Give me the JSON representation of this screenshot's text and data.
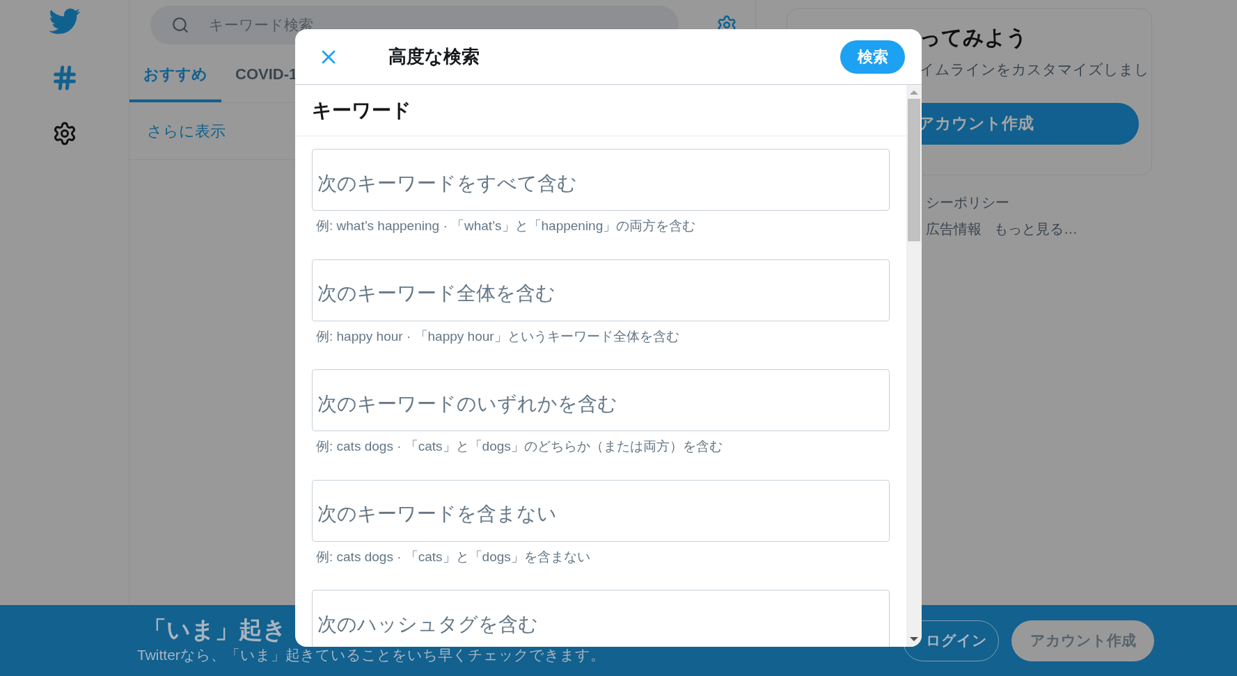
{
  "search": {
    "placeholder": "キーワード検索"
  },
  "tabs": [
    {
      "label": "おすすめ",
      "selected": true
    },
    {
      "label": "COVID-1",
      "selected": false
    }
  ],
  "show_more": "さらに表示",
  "side_card": {
    "title": "ってみよう",
    "text": "イムラインをカスタマイズしまし",
    "button": "アカウント作成"
  },
  "footer_links": [
    "シーポリシー",
    "広告情報",
    "もっと見る…"
  ],
  "banner": {
    "title": "「いま」起き",
    "subtitle": "Twitterなら、「いま」起きていることをいち早くチェックできます。",
    "buttons": [
      {
        "label": "ログイン",
        "kind": "outline"
      },
      {
        "label": "アカウント作成",
        "kind": "filled"
      }
    ]
  },
  "dialog": {
    "title": "高度な検索",
    "search_button": "検索",
    "section": "キーワード",
    "fields": [
      {
        "placeholder": "次のキーワードをすべて含む",
        "hint": "例: what’s happening · 「what’s」と「happening」の両方を含む"
      },
      {
        "placeholder": "次のキーワード全体を含む",
        "hint": "例: happy hour · 「happy hour」というキーワード全体を含む"
      },
      {
        "placeholder": "次のキーワードのいずれかを含む",
        "hint": "例: cats dogs · 「cats」と「dogs」のどちらか（または両方）を含む"
      },
      {
        "placeholder": "次のキーワードを含まない",
        "hint": "例: cats dogs · 「cats」と「dogs」を含まない"
      },
      {
        "placeholder": "次のハッシュタグを含む"
      }
    ]
  }
}
